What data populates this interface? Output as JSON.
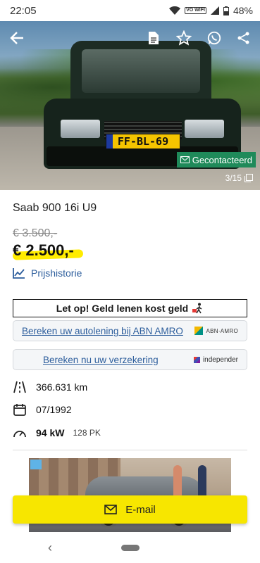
{
  "status_bar": {
    "time": "22:05",
    "battery": "48%",
    "volte": "VO WIFI"
  },
  "hero": {
    "plate": "FF-BL-69",
    "contacted_label": "Gecontacteerd",
    "image_counter": "3/15",
    "icons": [
      "back-arrow-icon",
      "document-icon",
      "star-icon",
      "whatsapp-icon",
      "share-icon"
    ]
  },
  "listing": {
    "title": "Saab 900 16i U9",
    "old_price": "€ 3.500,-",
    "price": "€ 2.500,-",
    "price_history": "Prijshistorie"
  },
  "warning": {
    "text": "Let op! Geld lenen kost geld"
  },
  "promos": [
    {
      "text": "Bereken uw autolening bij ABN AMRO",
      "logo": "ABN·AMRO"
    },
    {
      "text": "Bereken nu uw verzekering",
      "logo": "independer"
    }
  ],
  "specs": {
    "mileage": "366.631 km",
    "registration": "07/1992",
    "power_kw": "94 kW",
    "power_pk": "128 PK"
  },
  "actions": {
    "email": "E-mail"
  },
  "colors": {
    "accent": "#f7e600",
    "link": "#2c5d9c",
    "contacted": "#1f8a5a"
  }
}
